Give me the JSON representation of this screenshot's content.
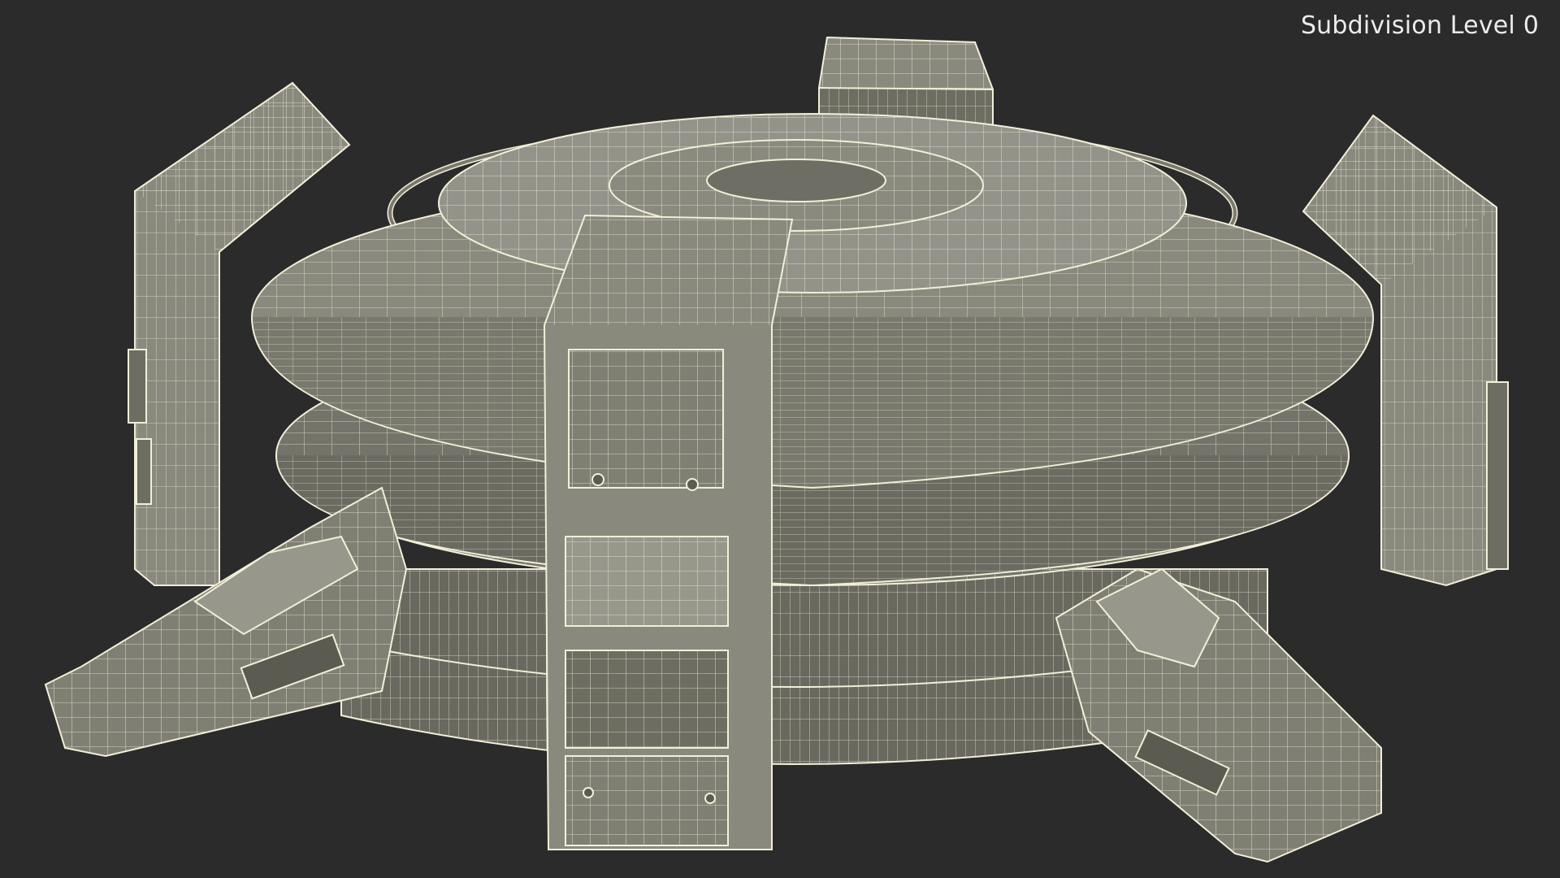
{
  "caption": "Subdivision Level 0",
  "colors": {
    "background": "#2b2b2b",
    "surface": "#807f73",
    "surface_light": "#98978b",
    "surface_dark": "#5c5b51",
    "wire": "#f2efd9"
  }
}
